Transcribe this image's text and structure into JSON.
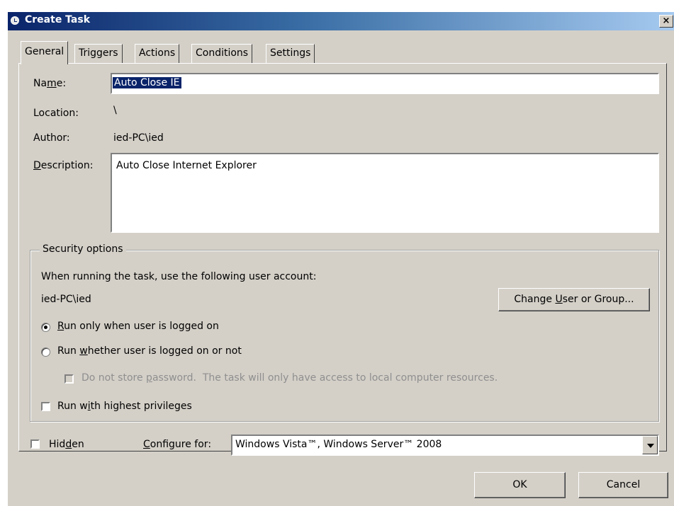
{
  "window": {
    "title": "Create Task",
    "close_glyph": "×"
  },
  "tabs": [
    "General",
    "Triggers",
    "Actions",
    "Conditions",
    "Settings"
  ],
  "general": {
    "name_label": "Name:",
    "name_value": "Auto Close IE",
    "location_label": "Location:",
    "location_value": "\\",
    "author_label": "Author:",
    "author_value": "ied-PC\\ied",
    "description_label": "Description:",
    "description_value": "Auto Close Internet Explorer"
  },
  "security": {
    "group_title": "Security options",
    "account_prompt": "When running the task, use the following user account:",
    "account_value": "ied-PC\\ied",
    "change_user_button": "Change User or Group...",
    "radio_logged_on": "Run only when user is logged on",
    "radio_logged_on_checked": true,
    "radio_whether": "Run whether user is logged on or not",
    "radio_whether_checked": false,
    "no_store_password": "Do not store password.  The task will only have access to local computer resources.",
    "no_store_password_enabled": false,
    "highest_privileges": "Run with highest privileges",
    "highest_privileges_checked": false
  },
  "bottom": {
    "hidden_label": "Hidden",
    "hidden_checked": false,
    "configure_label": "Configure for:",
    "configure_value": "Windows Vista™, Windows Server™ 2008"
  },
  "buttons": {
    "ok": "OK",
    "cancel": "Cancel"
  },
  "colors": {
    "title_bar_start": "#0a246a",
    "title_bar_end": "#a6caf0",
    "face": "#d4d0c8",
    "selection": "#0a246a"
  }
}
